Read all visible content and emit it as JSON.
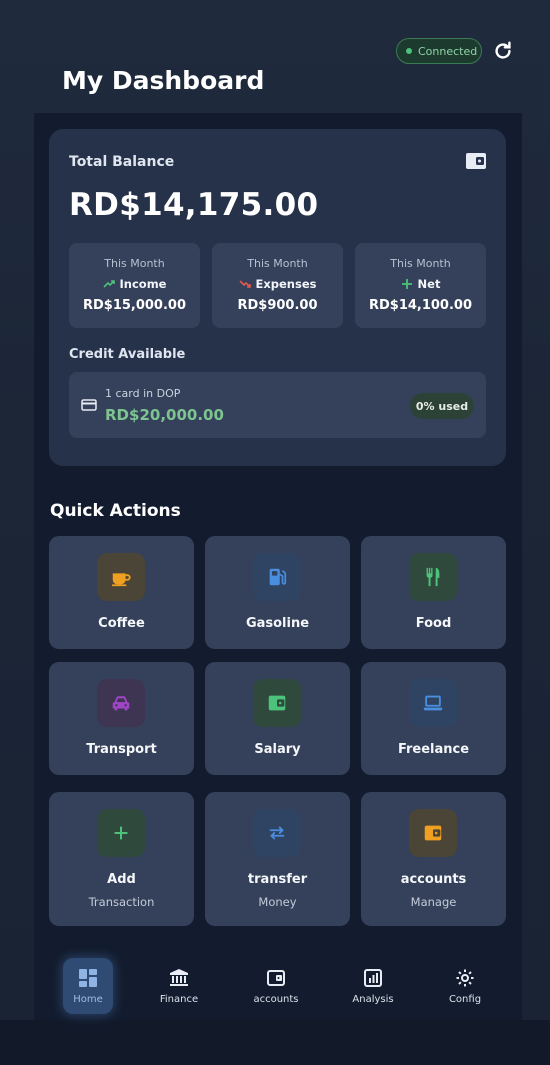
{
  "header": {
    "title": "My Dashboard",
    "status": "Connected"
  },
  "balance": {
    "label": "Total Balance",
    "amount": "RD$14,175.00",
    "stats": [
      {
        "period": "This Month",
        "kind": "Income",
        "value": "RD$15,000.00",
        "icon": "trending-up-icon",
        "color": "#4cc27a"
      },
      {
        "period": "This Month",
        "kind": "Expenses",
        "value": "RD$900.00",
        "icon": "trending-down-icon",
        "color": "#e05a4f"
      },
      {
        "period": "This Month",
        "kind": "Net",
        "value": "RD$14,100.00",
        "icon": "plus-icon",
        "color": "#4cc27a"
      }
    ]
  },
  "credit": {
    "label": "Credit Available",
    "count": "1 card in DOP",
    "amount": "RD$20,000.00",
    "used": "0% used"
  },
  "quick_actions": {
    "title": "Quick Actions",
    "items": [
      {
        "label": "Coffee",
        "icon": "coffee-icon",
        "color": "#f0a020"
      },
      {
        "label": "Gasoline",
        "icon": "gas-pump-icon",
        "color": "#4a8ee0"
      },
      {
        "label": "Food",
        "icon": "utensils-icon",
        "color": "#4cc27a"
      },
      {
        "label": "Transport",
        "icon": "car-icon",
        "color": "#a045c8"
      },
      {
        "label": "Salary",
        "icon": "wallet-icon",
        "color": "#4cc27a"
      },
      {
        "label": "Freelance",
        "icon": "laptop-icon",
        "color": "#4a8ee0"
      },
      {
        "label": "Add",
        "sub": "Transaction",
        "icon": "plus-icon",
        "color": "#4cc27a"
      },
      {
        "label": "transfer",
        "sub": "Money",
        "icon": "transfer-icon",
        "color": "#4a8ee0"
      },
      {
        "label": "accounts",
        "sub": "Manage",
        "icon": "wallet-icon",
        "color": "#f0a020"
      }
    ]
  },
  "nav": {
    "items": [
      {
        "label": "Home",
        "icon": "grid-icon",
        "active": true
      },
      {
        "label": "Finance",
        "icon": "bank-icon"
      },
      {
        "label": "accounts",
        "icon": "wallet-icon"
      },
      {
        "label": "Analysis",
        "icon": "chart-icon"
      },
      {
        "label": "Config",
        "icon": "gear-icon"
      }
    ]
  }
}
